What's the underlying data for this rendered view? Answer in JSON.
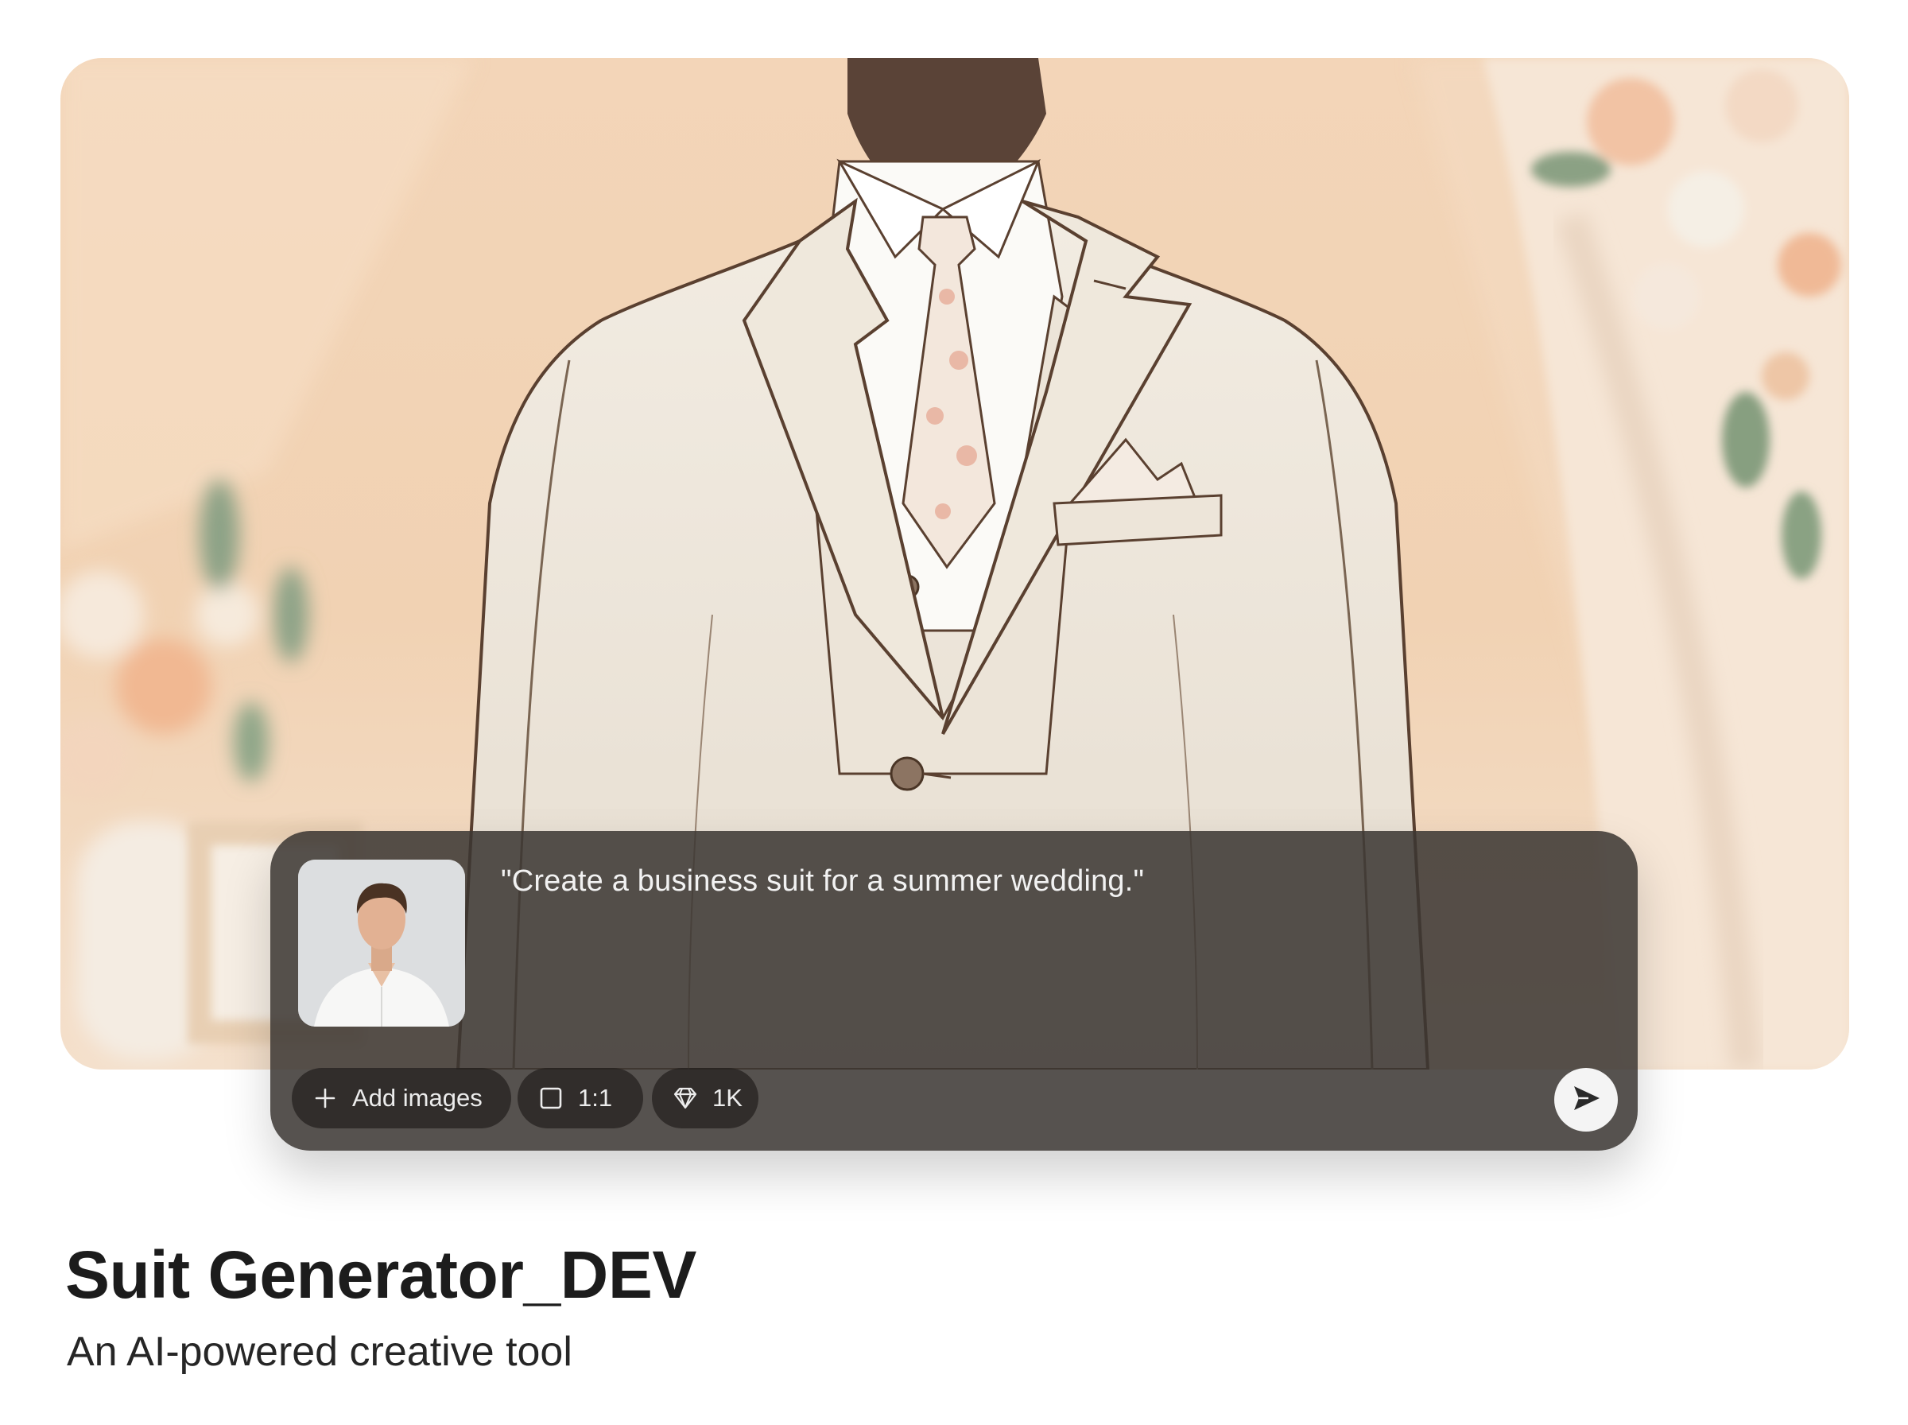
{
  "prompt": {
    "text": "\"Create a business suit for a summer wedding.\""
  },
  "toolbar": {
    "add_images_label": "Add images",
    "aspect_ratio_label": "1:1",
    "resolution_label": "1K"
  },
  "app": {
    "title": "Suit Generator_DEV",
    "subtitle": "An AI-powered creative tool"
  },
  "icons": {
    "add": "plus-icon",
    "aspect_ratio": "square-icon",
    "resolution": "diamond-icon",
    "send": "send-icon"
  },
  "colors": {
    "card_background": "#3a3632",
    "pill_background": "#221f1d",
    "send_button": "#f4f4f4",
    "title": "#1c1c1c"
  }
}
